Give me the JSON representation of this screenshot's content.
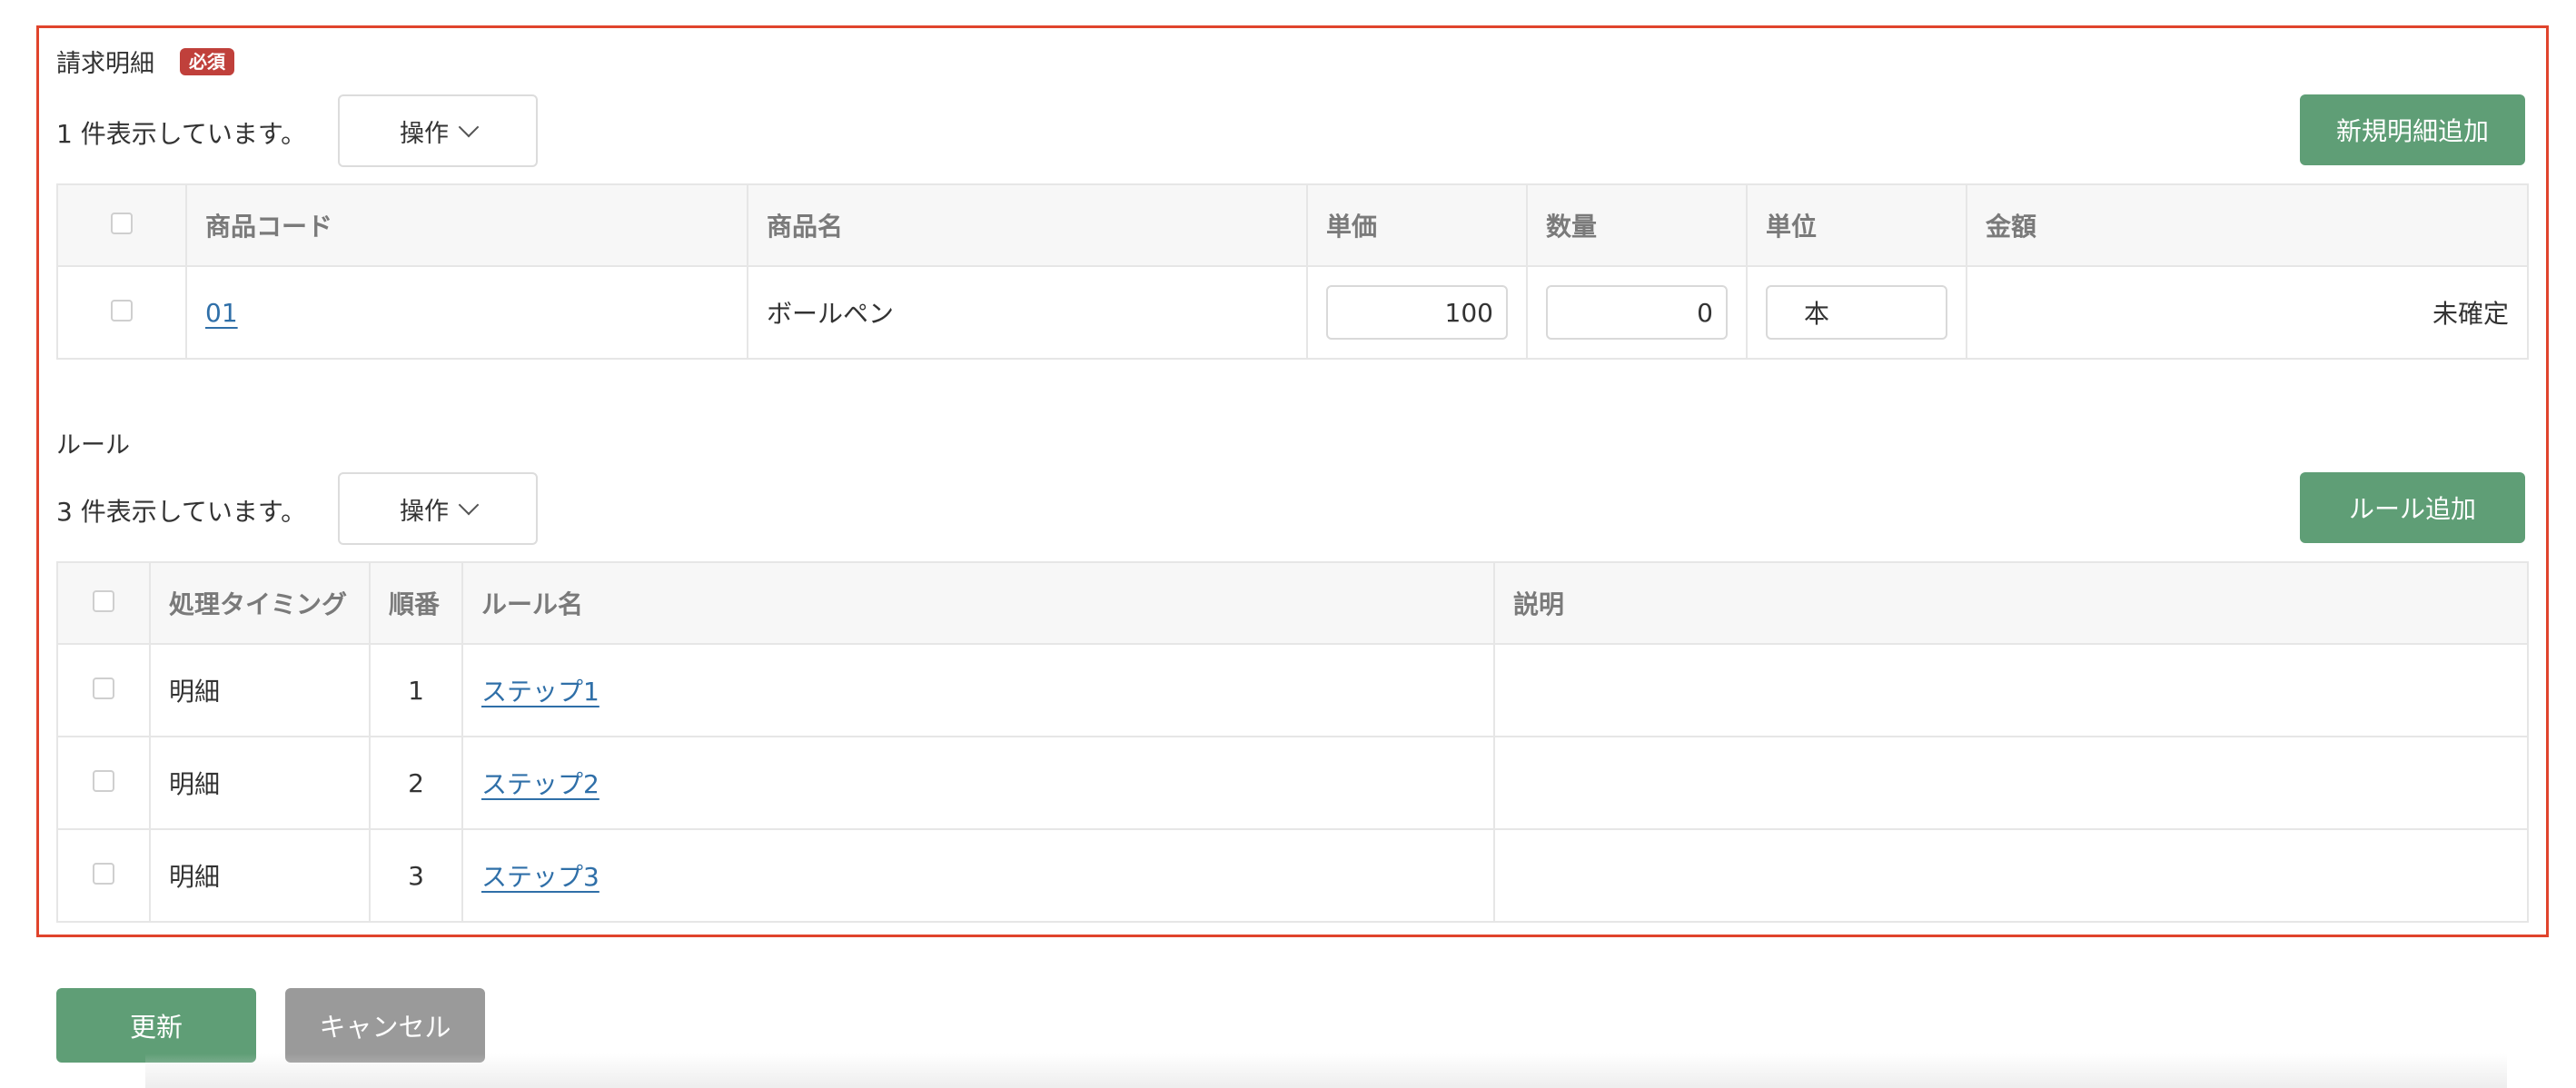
{
  "invoice": {
    "title": "請求明細",
    "required_badge": "必須",
    "count_text": "1 件表示しています。",
    "ops_label": "操作",
    "add_button": "新規明細追加",
    "columns": [
      "商品コード",
      "商品名",
      "単価",
      "数量",
      "単位",
      "金額"
    ],
    "rows": [
      {
        "code": "01",
        "name": "ボールペン",
        "unit_price": "100",
        "quantity": "0",
        "unit": "本",
        "amount": "未確定"
      }
    ]
  },
  "rules": {
    "title": "ルール",
    "count_text": "3 件表示しています。",
    "ops_label": "操作",
    "add_button": "ルール追加",
    "columns": [
      "処理タイミング",
      "順番",
      "ルール名",
      "説明"
    ],
    "rows": [
      {
        "timing": "明細",
        "order": "1",
        "name": "ステップ1",
        "description": ""
      },
      {
        "timing": "明細",
        "order": "2",
        "name": "ステップ2",
        "description": ""
      },
      {
        "timing": "明細",
        "order": "3",
        "name": "ステップ3",
        "description": ""
      }
    ]
  },
  "footer": {
    "update_button": "更新",
    "cancel_button": "キャンセル"
  },
  "colors": {
    "highlight_border": "#e0442c",
    "primary_green": "#5f9e76",
    "cancel_gray": "#9a9a9a",
    "required_red": "#c0403b",
    "link_blue": "#2f6fa8"
  }
}
